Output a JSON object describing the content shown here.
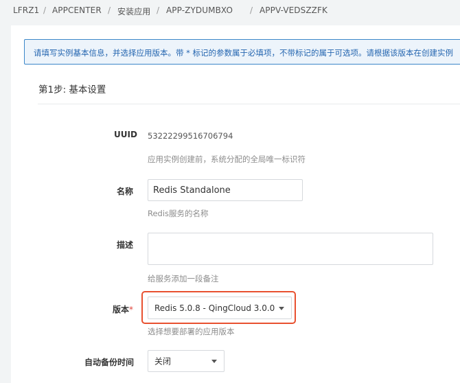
{
  "breadcrumb": {
    "items": [
      "LFRZ1",
      "APPCENTER",
      "安装应用",
      "APP-ZYDUMBXO",
      "APPV-VEDSZZFK"
    ],
    "separator": "/"
  },
  "notice": {
    "text": "请填写实例基本信息，并选择应用版本。带 * 标记的参数属于必填项，不带标记的属于可选项。请根据该版本在创建实例"
  },
  "step": {
    "title": "第1步: 基本设置"
  },
  "form": {
    "uuid": {
      "label": "UUID",
      "value": "53222299516706794",
      "hint": "应用实例创建前，系统分配的全局唯一标识符"
    },
    "name": {
      "label": "名称",
      "value": "Redis Standalone",
      "hint": "Redis服务的名称"
    },
    "description": {
      "label": "描述",
      "value": "",
      "hint": "给服务添加一段备注"
    },
    "version": {
      "label": "版本",
      "required_mark": "*",
      "selected": "Redis 5.0.8 - QingCloud 3.0.0",
      "hint": "选择想要部署的应用版本"
    },
    "backup": {
      "label": "自动备份时间",
      "selected": "关闭"
    }
  },
  "colors": {
    "highlight": "#e8502f",
    "notice_border": "#3a86c8",
    "notice_text": "#2566b0",
    "required": "#e0443b"
  }
}
